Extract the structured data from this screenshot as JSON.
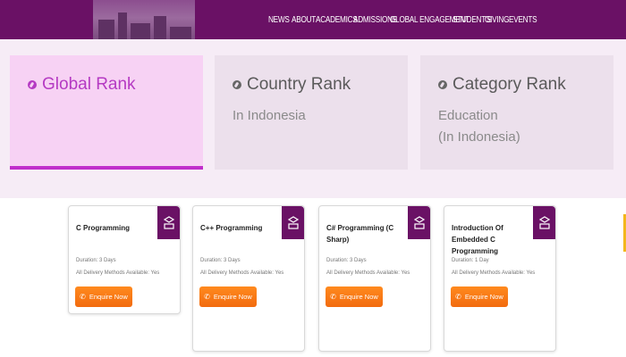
{
  "nav": {
    "items": [
      "NEWS",
      "ABOUT",
      "ACADEMICS",
      "ADMISSIONS",
      "GLOBAL ENGAGEMENT",
      "STUDENT'S",
      "GIVING",
      "EVENTS"
    ]
  },
  "ranks": [
    {
      "title": "Global Rank",
      "sub1": "",
      "sub2": "",
      "active": true
    },
    {
      "title": "Country Rank",
      "sub1": "In Indonesia",
      "sub2": ""
    },
    {
      "title": "Category Rank",
      "sub1": "Education",
      "sub2": "(In Indonesia)"
    }
  ],
  "courses": [
    {
      "title": "C Programming",
      "duration": "Duration: 3 Days",
      "delivery": "All Delivery Methods Available: Yes",
      "button": "Enquire Now"
    },
    {
      "title": "C++ Programming",
      "duration": "Duration: 3 Days",
      "delivery": "All Delivery Methods Available: Yes",
      "button": "Enquire Now"
    },
    {
      "title": "C# Programming (C Sharp)",
      "duration": "Duration: 3 Days",
      "delivery": "All Delivery Methods Available: Yes",
      "button": "Enquire Now"
    },
    {
      "title": "Introduction Of Embedded C Programming",
      "duration": "Duration: 1 Day",
      "delivery": "All Delivery Methods Available: Yes",
      "button": "Enquire Now"
    }
  ],
  "colors": {
    "brand_purple": "#6a1165",
    "accent_pink": "#c02ecb",
    "button_orange": "#f26b0f"
  }
}
